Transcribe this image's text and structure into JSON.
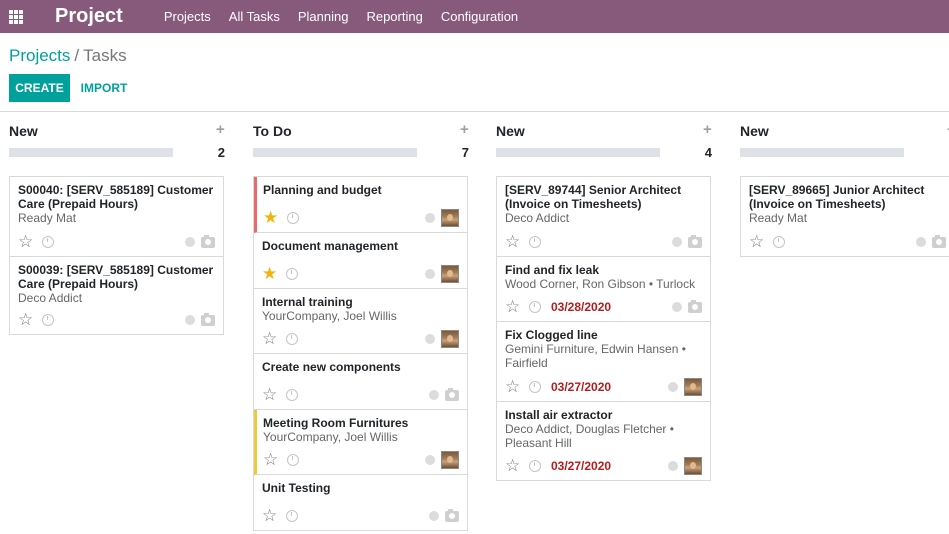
{
  "app": {
    "title": "Project"
  },
  "menu": [
    "Projects",
    "All Tasks",
    "Planning",
    "Reporting",
    "Configuration"
  ],
  "breadcrumb": {
    "parent": "Projects",
    "separator": "/",
    "current": "Tasks"
  },
  "buttons": {
    "create": "CREATE",
    "import": "IMPORT"
  },
  "colors": {
    "brand": "#875a7b",
    "primary": "#00a09d",
    "deadline": "#b71c1c",
    "star": "#f3b20e"
  },
  "columns": [
    {
      "title": "New",
      "count": "2",
      "cards": [
        {
          "title": "S00040: [SERV_585189] Customer Care (Prepaid Hours)",
          "sub": "Ready Mat",
          "starred": false,
          "deadline": "",
          "assignee": "none"
        },
        {
          "title": "S00039: [SERV_585189] Customer Care (Prepaid Hours)",
          "sub": "Deco Addict",
          "starred": false,
          "deadline": "",
          "assignee": "none"
        }
      ]
    },
    {
      "title": "To Do",
      "count": "7",
      "cards": [
        {
          "title": "Planning and budget",
          "sub": "",
          "starred": true,
          "deadline": "",
          "assignee": "avatar",
          "accent": "red"
        },
        {
          "title": "Document management",
          "sub": "",
          "starred": true,
          "deadline": "",
          "assignee": "avatar"
        },
        {
          "title": "Internal training",
          "sub": "YourCompany, Joel Willis",
          "starred": false,
          "deadline": "",
          "assignee": "avatar"
        },
        {
          "title": "Create new components",
          "sub": "",
          "starred": false,
          "deadline": "",
          "assignee": "none"
        },
        {
          "title": "Meeting Room Furnitures",
          "sub": "YourCompany, Joel Willis",
          "starred": false,
          "deadline": "",
          "assignee": "avatar",
          "accent": "yellow"
        },
        {
          "title": "Unit Testing",
          "sub": "",
          "starred": false,
          "deadline": "",
          "assignee": "none"
        }
      ]
    },
    {
      "title": "New",
      "count": "4",
      "cards": [
        {
          "title": "[SERV_89744] Senior Architect (Invoice on Timesheets)",
          "sub": "Deco Addict",
          "starred": false,
          "deadline": "",
          "assignee": "none"
        },
        {
          "title": "Find and fix leak",
          "sub": "Wood Corner, Ron Gibson • Turlock",
          "starred": false,
          "deadline": "03/28/2020",
          "assignee": "none"
        },
        {
          "title": "Fix Clogged line",
          "sub": "Gemini Furniture, Edwin Hansen • Fairfield",
          "starred": false,
          "deadline": "03/27/2020",
          "assignee": "avatar"
        },
        {
          "title": "Install air extractor",
          "sub": "Deco Addict, Douglas Fletcher • Pleasant Hill",
          "starred": false,
          "deadline": "03/27/2020",
          "assignee": "avatar"
        }
      ]
    },
    {
      "title": "New",
      "count": "",
      "cards": [
        {
          "title": "[SERV_89665] Junior Architect (Invoice on Timesheets)",
          "sub": "Ready Mat",
          "starred": false,
          "deadline": "",
          "assignee": "none"
        }
      ]
    }
  ]
}
